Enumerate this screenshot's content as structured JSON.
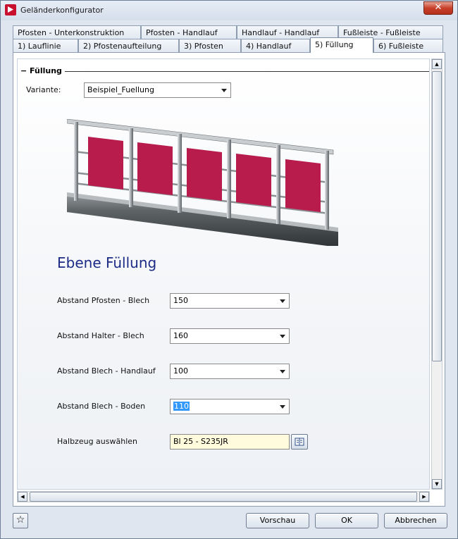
{
  "window": {
    "title": "Geländerkonfigurator",
    "close_glyph": "✕"
  },
  "tabs_row1": [
    "Pfosten - Unterkonstruktion",
    "Pfosten - Handlauf",
    "Handlauf - Handlauf",
    "Fußleiste - Fußleiste"
  ],
  "tabs_row2": [
    "1) Lauflinie",
    "2) Pfostenaufteilung",
    "3) Pfosten",
    "4) Handlauf",
    "5) Füllung",
    "6) Fußleiste"
  ],
  "active_tab": "5) Füllung",
  "group": {
    "title": "Füllung"
  },
  "variant": {
    "label": "Variante:",
    "value": "Beispiel_Fuellung"
  },
  "section_heading": "Ebene Füllung",
  "fields": [
    {
      "label": "Abstand Pfosten - Blech",
      "value": "150"
    },
    {
      "label": "Abstand Halter - Blech",
      "value": "160"
    },
    {
      "label": "Abstand Blech - Handlauf",
      "value": "100"
    },
    {
      "label": "Abstand Blech - Boden",
      "value": "110"
    }
  ],
  "halbzeug": {
    "label": "Halbzeug auswählen",
    "value": "Bl 25 - S235JR"
  },
  "buttons": {
    "preview": "Vorschau",
    "ok": "OK",
    "cancel": "Abbrechen"
  },
  "colors": {
    "panel_fill": "#b71c4c",
    "heading": "#1c2b86",
    "selection": "#3399ff"
  }
}
